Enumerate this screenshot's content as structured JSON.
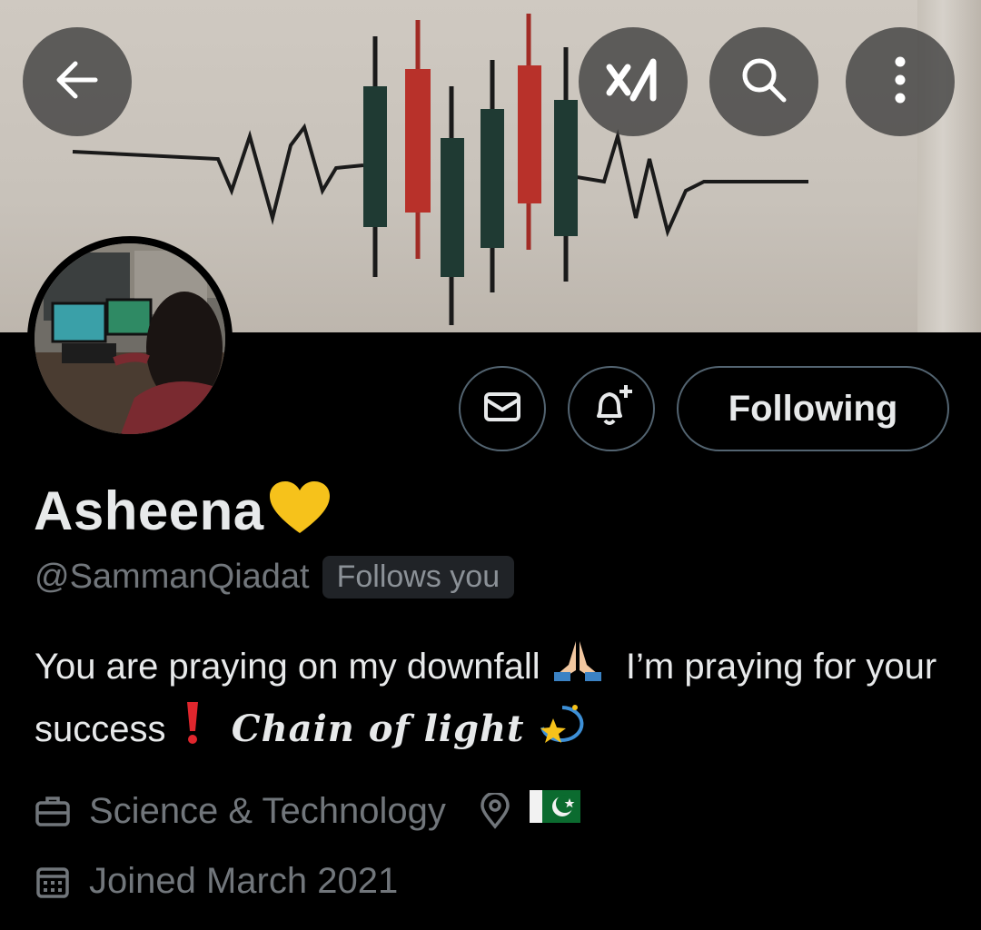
{
  "header": {
    "back_icon": "arrow-left-icon",
    "grok_icon": "grok-icon",
    "search_icon": "search-icon",
    "more_icon": "more-vertical-icon"
  },
  "profile": {
    "display_name": "Asheena",
    "name_emoji": "yellow-heart",
    "handle": "@SammanQiadat",
    "follows_badge": "Follows you",
    "bio_part1": "You are praying on my downfall",
    "bio_part2": "I’m praying for your success",
    "bio_part3": "Chain of light",
    "category": "Science & Technology",
    "location_flag": "Pakistan flag",
    "joined": "Joined March 2021"
  },
  "actions": {
    "message_icon": "envelope-icon",
    "notify_icon": "bell-plus-icon",
    "following_label": "Following"
  },
  "colors": {
    "background": "#000000",
    "primary_text": "#e7e9ea",
    "secondary_text": "#71767b",
    "border": "#536471",
    "candle_red": "#b8312a",
    "candle_green": "#1e3a34"
  }
}
